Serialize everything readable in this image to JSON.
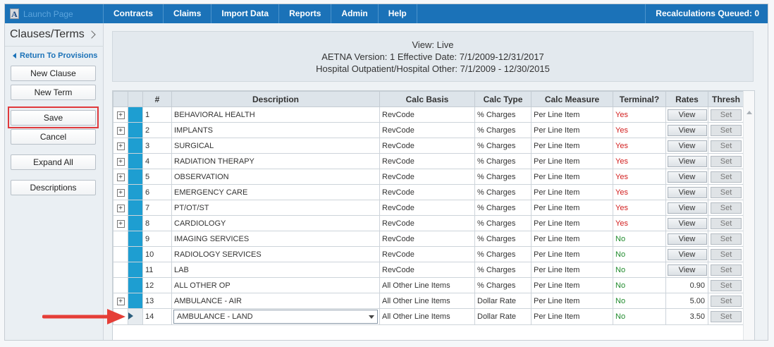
{
  "app": {
    "launch_label": "Launch Page",
    "logo_letter": "A",
    "menu": [
      "Contracts",
      "Claims",
      "Import Data",
      "Reports",
      "Admin",
      "Help"
    ],
    "recalc_label": "Recalculations Queued: 0"
  },
  "sidebar": {
    "title": "Clauses/Terms",
    "return_link": "Return To Provisions",
    "buttons": {
      "new_clause": "New Clause",
      "new_term": "New Term",
      "save": "Save",
      "cancel": "Cancel",
      "expand_all": "Expand All",
      "descriptions": "Descriptions"
    }
  },
  "view_info": {
    "line1": "View: Live",
    "line2": "AETNA Version: 1 Effective Date: 7/1/2009-12/31/2017",
    "line3": "Hospital Outpatient/Hospital Other: 7/1/2009 - 12/30/2015"
  },
  "table": {
    "columns": [
      "#",
      "Description",
      "Calc Basis",
      "Calc Type",
      "Calc Measure",
      "Terminal?",
      "Rates",
      "Thresh"
    ],
    "rows": [
      {
        "num": "1",
        "description": "BEHAVIORAL HEALTH",
        "calc_basis": "RevCode",
        "calc_type": "% Charges",
        "calc_measure": "Per Line Item",
        "terminal": "Yes",
        "rates": "View",
        "thresh": "Set",
        "expandable": true
      },
      {
        "num": "2",
        "description": "IMPLANTS",
        "calc_basis": "RevCode",
        "calc_type": "% Charges",
        "calc_measure": "Per Line Item",
        "terminal": "Yes",
        "rates": "View",
        "thresh": "Set",
        "expandable": true
      },
      {
        "num": "3",
        "description": "SURGICAL",
        "calc_basis": "RevCode",
        "calc_type": "% Charges",
        "calc_measure": "Per Line Item",
        "terminal": "Yes",
        "rates": "View",
        "thresh": "Set",
        "expandable": true
      },
      {
        "num": "4",
        "description": "RADIATION THERAPY",
        "calc_basis": "RevCode",
        "calc_type": "% Charges",
        "calc_measure": "Per Line Item",
        "terminal": "Yes",
        "rates": "View",
        "thresh": "Set",
        "expandable": true
      },
      {
        "num": "5",
        "description": "OBSERVATION",
        "calc_basis": "RevCode",
        "calc_type": "% Charges",
        "calc_measure": "Per Line Item",
        "terminal": "Yes",
        "rates": "View",
        "thresh": "Set",
        "expandable": true
      },
      {
        "num": "6",
        "description": "EMERGENCY CARE",
        "calc_basis": "RevCode",
        "calc_type": "% Charges",
        "calc_measure": "Per Line Item",
        "terminal": "Yes",
        "rates": "View",
        "thresh": "Set",
        "expandable": true
      },
      {
        "num": "7",
        "description": "PT/OT/ST",
        "calc_basis": "RevCode",
        "calc_type": "% Charges",
        "calc_measure": "Per Line Item",
        "terminal": "Yes",
        "rates": "View",
        "thresh": "Set",
        "expandable": true
      },
      {
        "num": "8",
        "description": "CARDIOLOGY",
        "calc_basis": "RevCode",
        "calc_type": "% Charges",
        "calc_measure": "Per Line Item",
        "terminal": "Yes",
        "rates": "View",
        "thresh": "Set",
        "expandable": true
      },
      {
        "num": "9",
        "description": "IMAGING SERVICES",
        "calc_basis": "RevCode",
        "calc_type": "% Charges",
        "calc_measure": "Per Line Item",
        "terminal": "No",
        "rates": "View",
        "thresh": "Set",
        "expandable": false
      },
      {
        "num": "10",
        "description": "RADIOLOGY SERVICES",
        "calc_basis": "RevCode",
        "calc_type": "% Charges",
        "calc_measure": "Per Line Item",
        "terminal": "No",
        "rates": "View",
        "thresh": "Set",
        "expandable": false
      },
      {
        "num": "11",
        "description": "LAB",
        "calc_basis": "RevCode",
        "calc_type": "% Charges",
        "calc_measure": "Per Line Item",
        "terminal": "No",
        "rates": "View",
        "thresh": "Set",
        "expandable": false
      },
      {
        "num": "12",
        "description": "ALL OTHER OP",
        "calc_basis": "All Other Line Items",
        "calc_type": "% Charges",
        "calc_measure": "Per Line Item",
        "terminal": "No",
        "rates": "0.90",
        "thresh": "Set",
        "expandable": false
      },
      {
        "num": "13",
        "description": "AMBULANCE - AIR",
        "calc_basis": "All Other Line Items",
        "calc_type": "Dollar Rate",
        "calc_measure": "Per Line Item",
        "terminal": "No",
        "rates": "5.00",
        "thresh": "Set",
        "expandable": true
      },
      {
        "num": "14",
        "description": "AMBULANCE - LAND",
        "calc_basis": "All Other Line Items",
        "calc_type": "Dollar Rate",
        "calc_measure": "Per Line Item",
        "terminal": "No",
        "rates": "3.50",
        "thresh": "Set",
        "expandable": false,
        "editing": true
      }
    ]
  },
  "colors": {
    "topbar": "#1b72b8",
    "row_indicator": "#1e9ed1",
    "terminal_yes": "#d21f1f",
    "terminal_no": "#1f8a2c",
    "highlight": "#e0393c"
  }
}
